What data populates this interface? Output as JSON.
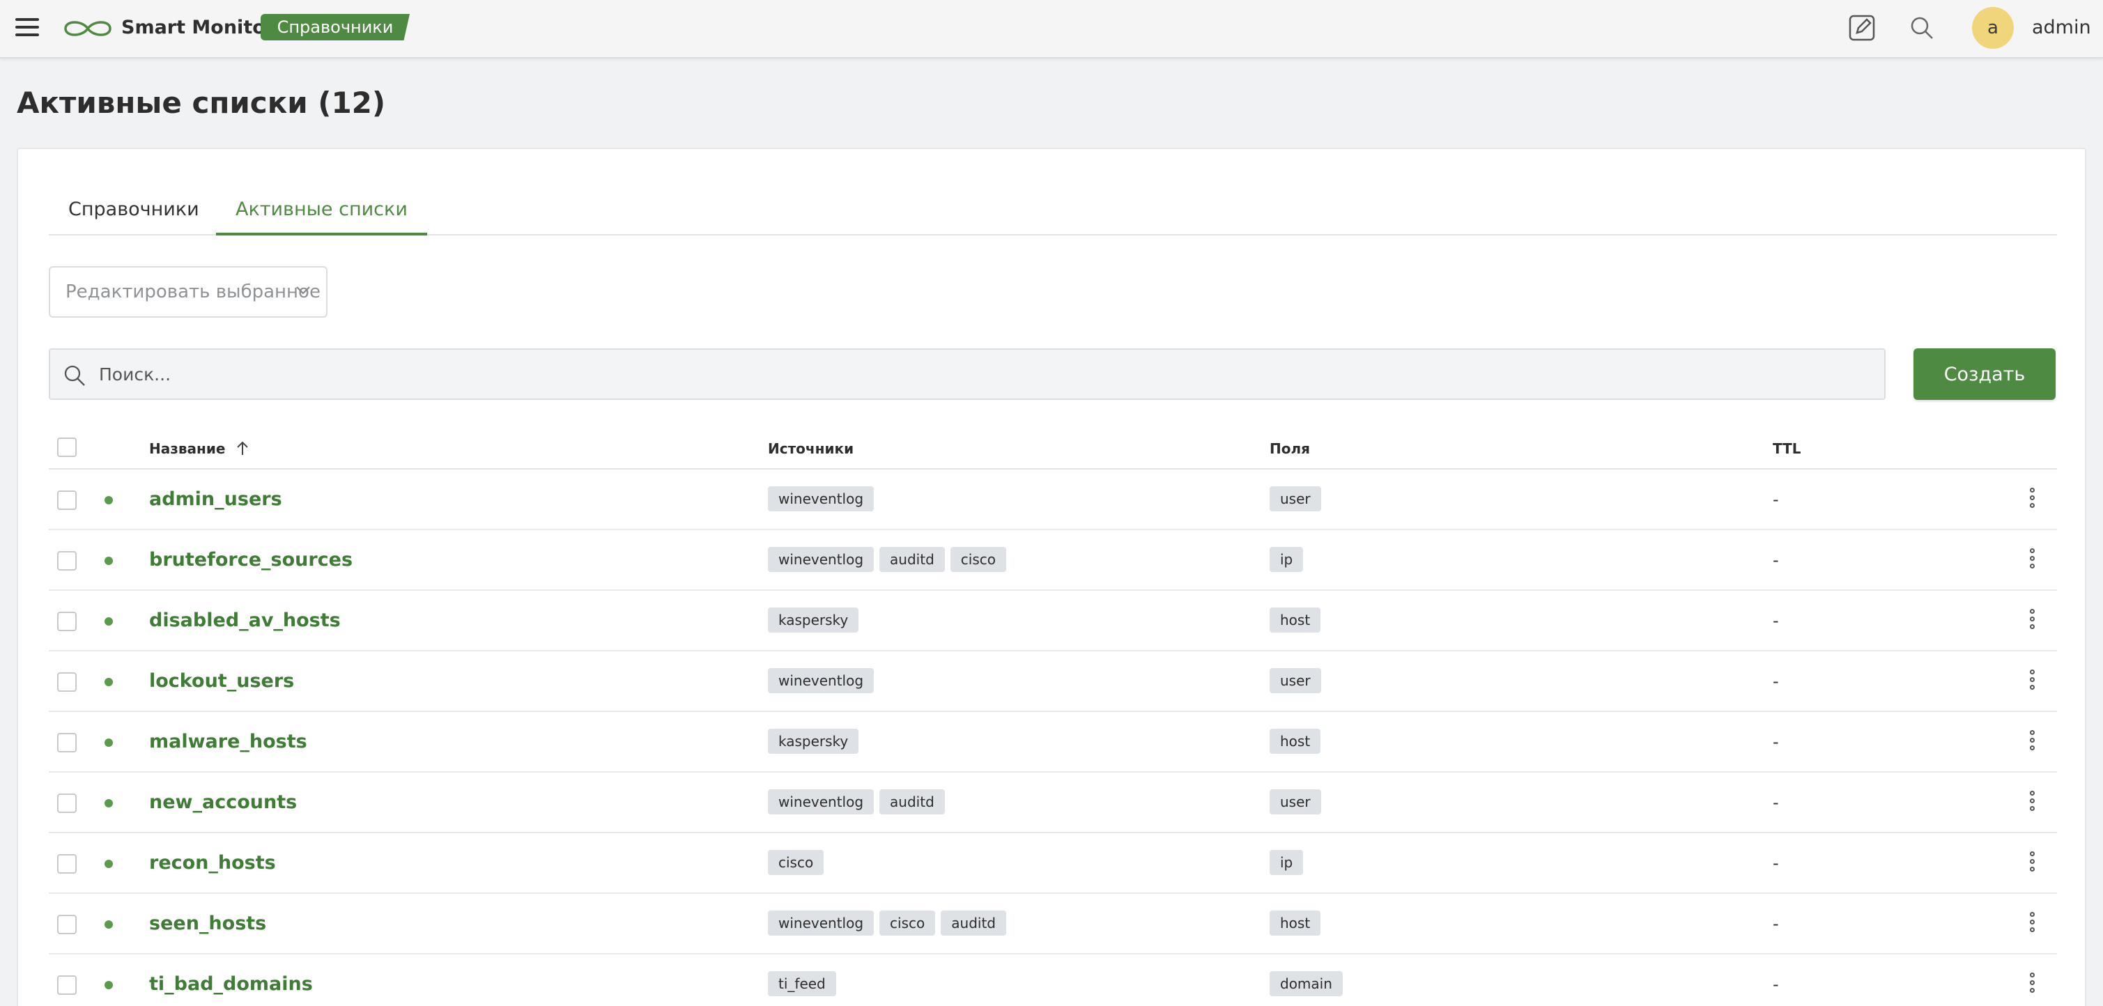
{
  "header": {
    "app_name": "Smart Monitor",
    "section_badge": "Справочники",
    "avatar_letter": "a",
    "username": "admin",
    "accent_color": "#4f8a43"
  },
  "page": {
    "title": "Активные списки (12)"
  },
  "tabs": [
    {
      "label": "Справочники",
      "active": false
    },
    {
      "label": "Активные списки",
      "active": true
    }
  ],
  "toolbar": {
    "bulk_edit_label": "Редактировать выбранное",
    "search_placeholder": "Поиск...",
    "create_label": "Создать"
  },
  "table": {
    "columns": {
      "name": "Название",
      "sources": "Источники",
      "fields": "Поля",
      "ttl": "TTL"
    },
    "sort": {
      "column": "name",
      "direction": "asc"
    },
    "rows": [
      {
        "name": "admin_users",
        "sources": [
          "wineventlog"
        ],
        "fields": [
          "user"
        ],
        "ttl": "-"
      },
      {
        "name": "bruteforce_sources",
        "sources": [
          "wineventlog",
          "auditd",
          "cisco"
        ],
        "fields": [
          "ip"
        ],
        "ttl": "-"
      },
      {
        "name": "disabled_av_hosts",
        "sources": [
          "kaspersky"
        ],
        "fields": [
          "host"
        ],
        "ttl": "-"
      },
      {
        "name": "lockout_users",
        "sources": [
          "wineventlog"
        ],
        "fields": [
          "user"
        ],
        "ttl": "-"
      },
      {
        "name": "malware_hosts",
        "sources": [
          "kaspersky"
        ],
        "fields": [
          "host"
        ],
        "ttl": "-"
      },
      {
        "name": "new_accounts",
        "sources": [
          "wineventlog",
          "auditd"
        ],
        "fields": [
          "user"
        ],
        "ttl": "-"
      },
      {
        "name": "recon_hosts",
        "sources": [
          "cisco"
        ],
        "fields": [
          "ip"
        ],
        "ttl": "-"
      },
      {
        "name": "seen_hosts",
        "sources": [
          "wineventlog",
          "cisco",
          "auditd"
        ],
        "fields": [
          "host"
        ],
        "ttl": "-"
      },
      {
        "name": "ti_bad_domains",
        "sources": [
          "ti_feed"
        ],
        "fields": [
          "domain"
        ],
        "ttl": "-"
      }
    ]
  }
}
